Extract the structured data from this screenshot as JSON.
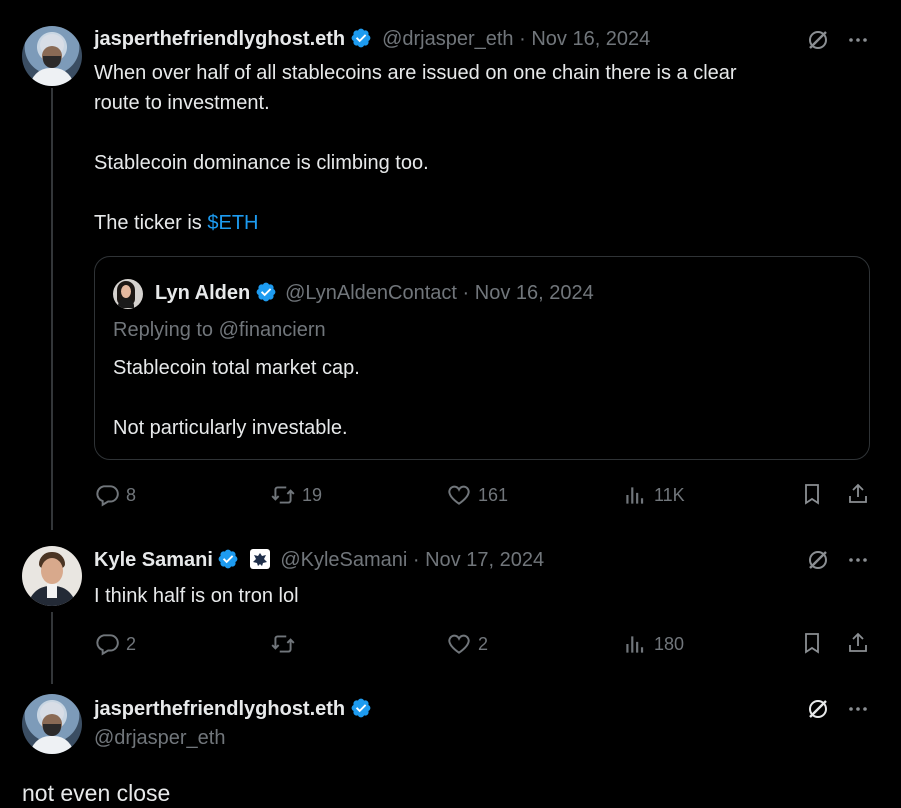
{
  "tweet1": {
    "display_name": "jasperthefriendlyghost.eth",
    "handle_date": "@drjasper_eth · Nov 16, 2024",
    "line1": "When over half of all stablecoins are issued on one chain there is a clear",
    "line2": "route to investment.",
    "line3": "Stablecoin dominance is climbing too.",
    "line4_prefix": "The ticker is ",
    "ticker": "$ETH",
    "quote": {
      "display_name": "Lyn Alden",
      "handle_date": "@LynAldenContact · Nov 16, 2024",
      "replying_to": "Replying to @financiern",
      "line1": "Stablecoin total market cap.",
      "line2": "Not particularly investable."
    },
    "stats": {
      "replies": "8",
      "reposts": "19",
      "likes": "161",
      "views": "11K"
    }
  },
  "tweet2": {
    "display_name": "Kyle Samani",
    "handle_date": "@KyleSamani · Nov 17, 2024",
    "text": "I think half is on tron lol",
    "stats": {
      "replies": "2",
      "reposts": "",
      "likes": "2",
      "views": "180"
    }
  },
  "tweet3": {
    "display_name": "jasperthefriendlyghost.eth",
    "handle": "@drjasper_eth",
    "text": "not even close"
  },
  "colors": {
    "accent": "#1d9bf0",
    "muted": "#71767b",
    "text": "#e7e9ea",
    "background": "#000000"
  },
  "icons": [
    "verified-badge-icon",
    "grok-icon",
    "more-icon",
    "reply-icon",
    "repost-icon",
    "like-icon",
    "views-icon",
    "bookmark-icon",
    "share-icon"
  ]
}
